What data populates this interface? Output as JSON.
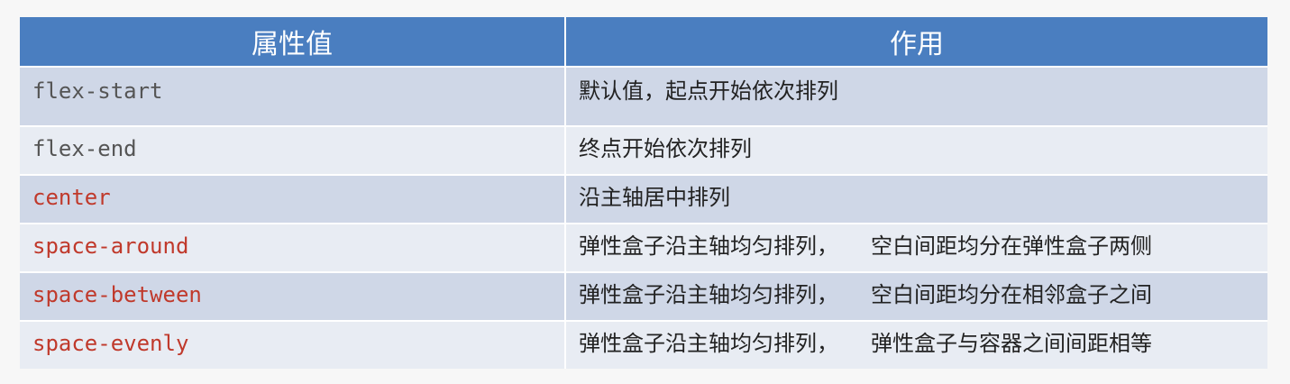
{
  "table": {
    "headers": [
      "属性值",
      "作用"
    ],
    "rows": [
      {
        "value": "flex-start",
        "desc_a": "默认值，起点开始依次排列",
        "desc_b": ""
      },
      {
        "value": "flex-end",
        "desc_a": "终点开始依次排列",
        "desc_b": ""
      },
      {
        "value": "center",
        "desc_a": "沿主轴居中排列",
        "desc_b": ""
      },
      {
        "value": "space-around",
        "desc_a": "弹性盒子沿主轴均匀排列，",
        "desc_b": "空白间距均分在弹性盒子两侧"
      },
      {
        "value": "space-between",
        "desc_a": "弹性盒子沿主轴均匀排列，",
        "desc_b": "空白间距均分在相邻盒子之间"
      },
      {
        "value": "space-evenly",
        "desc_a": "弹性盒子沿主轴均匀排列，",
        "desc_b": "弹性盒子与容器之间间距相等"
      }
    ]
  },
  "colors": {
    "header_bg": "#4a7ec0",
    "row_dark": "#cfd7e7",
    "row_light": "#e8ecf3",
    "value_gray": "#555555",
    "value_red": "#c0392b"
  }
}
